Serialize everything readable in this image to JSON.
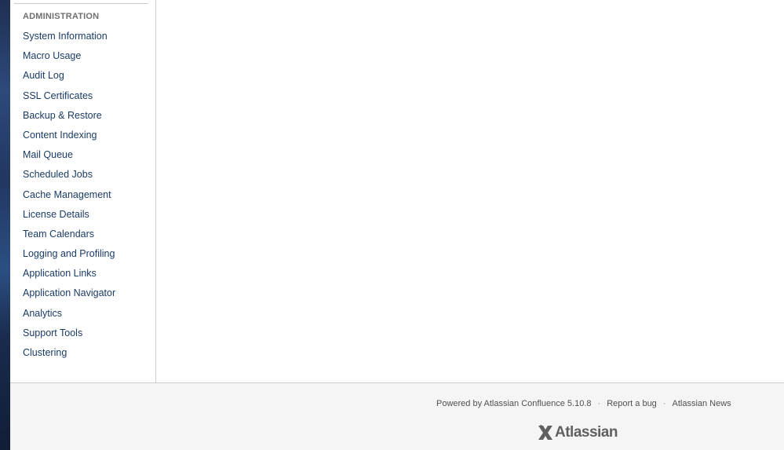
{
  "sidebar": {
    "heading": "ADMINISTRATION",
    "items": [
      {
        "label": "System Information"
      },
      {
        "label": "Macro Usage"
      },
      {
        "label": "Audit Log"
      },
      {
        "label": "SSL Certificates"
      },
      {
        "label": "Backup & Restore"
      },
      {
        "label": "Content Indexing"
      },
      {
        "label": "Mail Queue"
      },
      {
        "label": "Scheduled Jobs"
      },
      {
        "label": "Cache Management"
      },
      {
        "label": "License Details"
      },
      {
        "label": "Team Calendars"
      },
      {
        "label": "Logging and Profiling"
      },
      {
        "label": "Application Links"
      },
      {
        "label": "Application Navigator"
      },
      {
        "label": "Analytics"
      },
      {
        "label": "Support Tools"
      },
      {
        "label": "Clustering"
      }
    ]
  },
  "footer": {
    "powered_by": "Powered by Atlassian Confluence 5.10.8",
    "separator": "·",
    "report_bug": "Report a bug",
    "news": "Atlassian News",
    "logo_text": "Atlassian",
    "logo_icon": "atlassian-x-icon"
  },
  "colors": {
    "link": "#1a3b66",
    "heading": "#707070",
    "footer_bg": "#f5f5f5",
    "border": "#cccccc"
  }
}
